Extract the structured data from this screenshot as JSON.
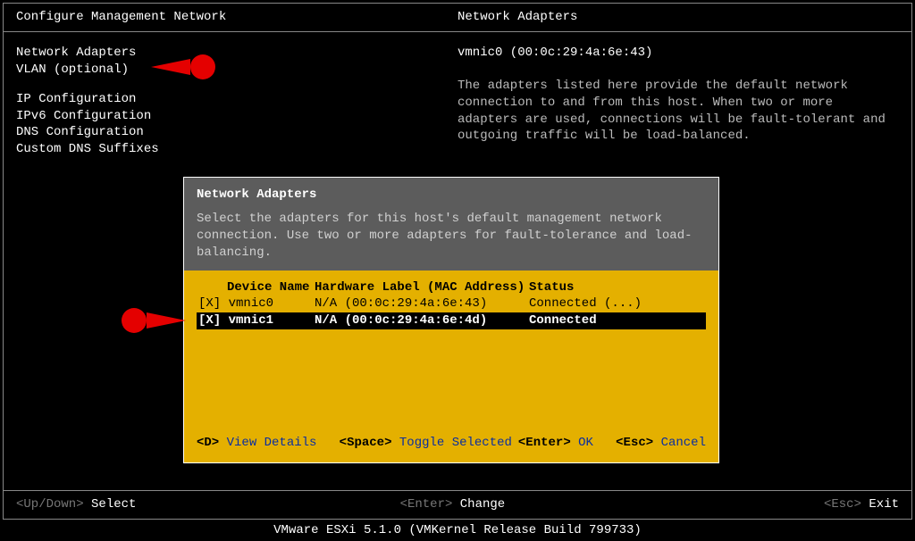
{
  "header": {
    "left": "Configure Management Network",
    "right": "Network Adapters"
  },
  "menu": [
    "Network Adapters",
    "VLAN (optional)",
    "",
    "IP Configuration",
    "IPv6 Configuration",
    "DNS Configuration",
    "Custom DNS Suffixes"
  ],
  "detail": {
    "title": "vmnic0 (00:0c:29:4a:6e:43)",
    "desc": "The adapters listed here provide the default network connection to and from this host. When two or more adapters are used, connections will be fault-tolerant and outgoing traffic will be load-balanced."
  },
  "dialog": {
    "title": "Network Adapters",
    "desc": "Select the adapters for this host's default management network connection. Use two or more adapters for fault-tolerance and load-balancing.",
    "columns": {
      "dev": "Device Name",
      "hw": "Hardware Label (MAC Address)",
      "stat": "Status"
    },
    "rows": [
      {
        "mark": "[X]",
        "dev": "vmnic0",
        "hw": "N/A (00:0c:29:4a:6e:43)",
        "stat": "Connected (...)",
        "selected": false
      },
      {
        "mark": "[X]",
        "dev": "vmnic1",
        "hw": "N/A (00:0c:29:4a:6e:4d)",
        "stat": "Connected",
        "selected": true
      }
    ],
    "keys": {
      "d": "<D>",
      "d_action": "View Details",
      "space": "<Space>",
      "space_action": "Toggle Selected",
      "enter": "<Enter>",
      "enter_action": "OK",
      "esc": "<Esc>",
      "esc_action": "Cancel"
    }
  },
  "footer": {
    "left_key": "<Up/Down>",
    "left_action": "Select",
    "center_key": "<Enter>",
    "center_action": "Change",
    "right_key": "<Esc>",
    "right_action": "Exit"
  },
  "status": "VMware ESXi 5.1.0 (VMKernel Release Build 799733)"
}
